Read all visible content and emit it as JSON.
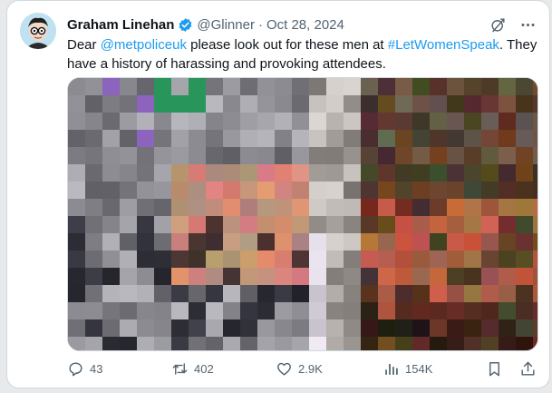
{
  "tweet": {
    "author_name": "Graham Linehan",
    "handle": "@Glinner",
    "separator": "·",
    "date": "Oct 28, 2024",
    "text_before_mention": "Dear ",
    "mention": "@metpoliceuk",
    "text_after_mention": " please look out for these men at ",
    "hashtag": "#LetWomenSpeak",
    "text_end": ". They have a history of harassing and provoking attendees."
  },
  "header_icons": [
    "verified-badge-icon",
    "grok-icon",
    "more-icon"
  ],
  "stats": {
    "replies": "43",
    "reposts": "402",
    "likes": "2.9K",
    "views": "154K"
  },
  "colors": {
    "accent": "#1d9bf0",
    "text": "#0f1419",
    "muted": "#536471",
    "border": "#cfd9de"
  }
}
